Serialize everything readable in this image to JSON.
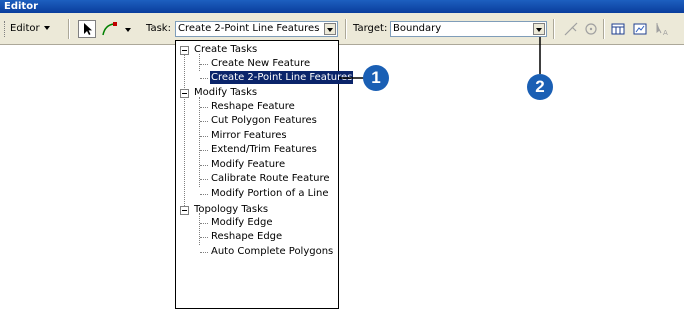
{
  "window": {
    "title": "Editor"
  },
  "toolbar": {
    "editor_menu": "Editor",
    "task_label": "Task:",
    "task_value": "Create 2-Point Line Features",
    "target_label": "Target:",
    "target_value": "Boundary"
  },
  "task_tree": {
    "groups": [
      {
        "label": "Create Tasks",
        "items": [
          "Create New Feature",
          "Create 2-Point Line Features"
        ]
      },
      {
        "label": "Modify Tasks",
        "items": [
          "Reshape Feature",
          "Cut Polygon Features",
          "Mirror Features",
          "Extend/Trim Features",
          "Modify Feature",
          "Calibrate Route Feature",
          "Modify Portion of a Line"
        ]
      },
      {
        "label": "Topology Tasks",
        "items": [
          "Modify Edge",
          "Reshape Edge",
          "Auto Complete Polygons"
        ]
      }
    ],
    "selected_item": "Create 2-Point Line Features"
  },
  "callouts": [
    "1",
    "2"
  ],
  "colors": {
    "title_bar": "#0a3d9c",
    "selection": "#0a246a",
    "callout": "#1a5fb4",
    "toolbar": "#ece9d8"
  }
}
